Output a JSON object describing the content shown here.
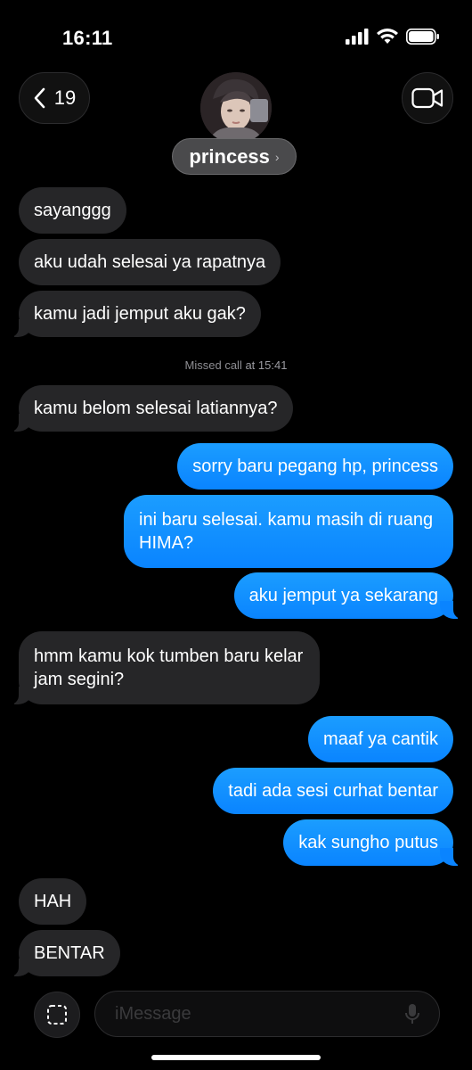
{
  "status_bar": {
    "time": "16:11"
  },
  "header": {
    "back_count": "19",
    "contact_name": "princess",
    "chevron": "›"
  },
  "missed_call": {
    "label": "Missed call",
    "time": "at 15:41"
  },
  "messages": [
    {
      "dir": "in",
      "text": "sayanggg"
    },
    {
      "dir": "in",
      "text": "aku udah selesai ya rapatnya"
    },
    {
      "dir": "in",
      "text": "kamu jadi jemput aku gak?"
    },
    {
      "dir": "in",
      "text": "kamu belom selesai latiannya?"
    },
    {
      "dir": "out",
      "text": "sorry baru pegang hp, princess"
    },
    {
      "dir": "out",
      "text": "ini baru selesai. kamu masih di ruang HIMA?"
    },
    {
      "dir": "out",
      "text": "aku jemput ya sekarang"
    },
    {
      "dir": "in",
      "text": "hmm kamu kok tumben baru kelar jam segini?"
    },
    {
      "dir": "out",
      "text": "maaf ya cantik"
    },
    {
      "dir": "out",
      "text": "tadi ada sesi curhat bentar"
    },
    {
      "dir": "out",
      "text": "kak sungho putus"
    },
    {
      "dir": "in",
      "text": "HAH"
    },
    {
      "dir": "in",
      "text": "BENTAR"
    }
  ],
  "composer": {
    "placeholder": "iMessage"
  },
  "icons": {
    "back": "chevron-left-icon",
    "video": "video-camera-icon",
    "apps": "apps-icon",
    "mic": "microphone-icon"
  }
}
